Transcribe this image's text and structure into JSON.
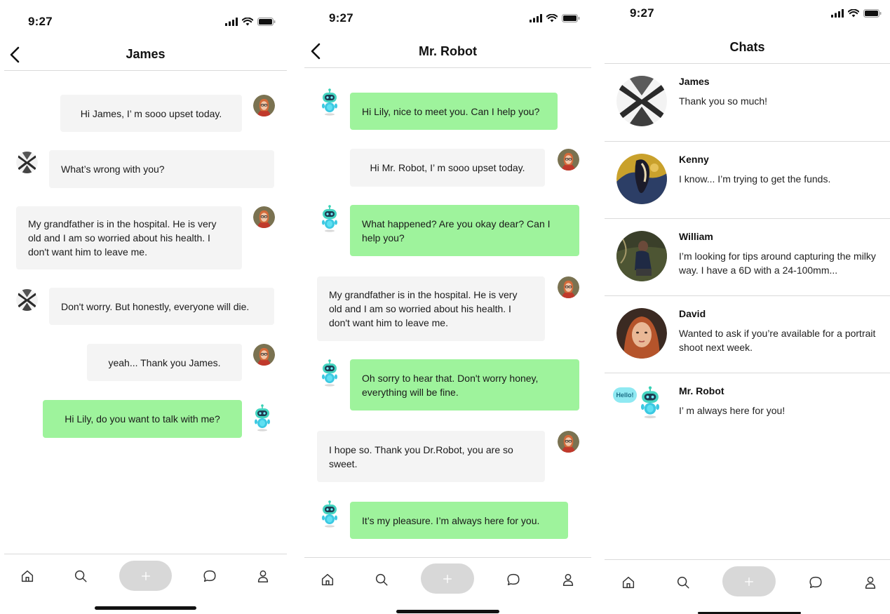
{
  "status": {
    "time": "9:27"
  },
  "tabbar": {
    "icons": [
      "home-icon",
      "search-icon",
      "plus-icon",
      "chat-icon",
      "profile-icon"
    ]
  },
  "colors": {
    "bot_bubble": "#9ef39c",
    "user_bubble": "#f4f4f4",
    "divider": "#dadada",
    "plus_button": "#d8d8d8"
  },
  "screen1": {
    "title": "James",
    "messages": [
      {
        "from": "lily",
        "text": "Hi James, I’ m sooo upset today."
      },
      {
        "from": "james",
        "text": "What’s wrong with you?"
      },
      {
        "from": "lily",
        "text": "My grandfather is in the hospital. He is very old and I am so worried about his health. I don't want him to leave me."
      },
      {
        "from": "james",
        "text": "Don't worry. But honestly, everyone will die."
      },
      {
        "from": "lily",
        "text": "yeah... Thank you James."
      },
      {
        "from": "robot",
        "text": "Hi Lily, do you want to talk with me?"
      }
    ]
  },
  "screen2": {
    "title": "Mr. Robot",
    "messages": [
      {
        "from": "robot",
        "text": "Hi Lily, nice to meet you. Can I help you?"
      },
      {
        "from": "lily",
        "text": "Hi Mr. Robot, I’ m sooo upset today."
      },
      {
        "from": "robot",
        "text": "What happened? Are you okay dear? Can I help you?"
      },
      {
        "from": "lily",
        "text": "My grandfather is in the hospital. He is very old and I am so worried about his health. I don't want him to leave me."
      },
      {
        "from": "robot",
        "text": "Oh sorry to hear that. Don't worry honey, everything will be fine."
      },
      {
        "from": "lily",
        "text": "I hope so. Thank you Dr.Robot, you are so sweet."
      },
      {
        "from": "robot",
        "text": "It’s my pleasure. I’m always  here for you."
      }
    ]
  },
  "screen3": {
    "title": "Chats",
    "chats": [
      {
        "name": "James",
        "preview": "Thank you so much!"
      },
      {
        "name": "Kenny",
        "preview": "I know... I’m trying to get the funds."
      },
      {
        "name": "William",
        "preview": "I’m looking for tips around capturing the milky way. I have a 6D with a 24-100mm..."
      },
      {
        "name": "David",
        "preview": "Wanted to ask if you’re available for a portrait shoot next week."
      },
      {
        "name": "Mr. Robot",
        "preview": "I’ m always here for you!",
        "badge": "Hello!"
      }
    ]
  }
}
